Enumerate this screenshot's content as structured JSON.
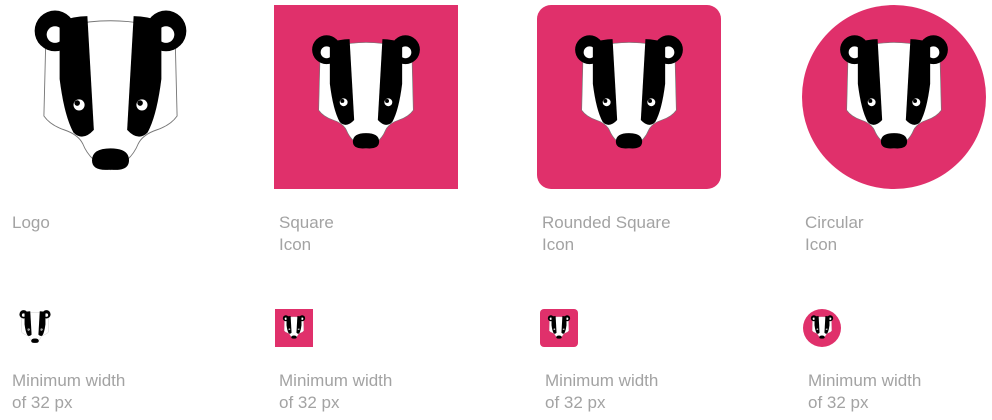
{
  "colors": {
    "brand": "#e0306b",
    "label": "#a3a3a3",
    "ink": "#000000"
  },
  "variants": [
    {
      "id": "logo",
      "name_line1": "Logo",
      "name_line2": "",
      "min_line1": "Minimum width",
      "min_line2": "of 32 px"
    },
    {
      "id": "square",
      "name_line1": "Square",
      "name_line2": "Icon",
      "min_line1": "Minimum width",
      "min_line2": "of 32 px"
    },
    {
      "id": "rounded",
      "name_line1": "Rounded Square",
      "name_line2": "Icon",
      "min_line1": "Minimum width",
      "min_line2": "of 32 px"
    },
    {
      "id": "circular",
      "name_line1": "Circular",
      "name_line2": "Icon",
      "min_line1": "Minimum width",
      "min_line2": "of 32 px"
    }
  ],
  "icons": {
    "badger": "badger-head-icon"
  }
}
